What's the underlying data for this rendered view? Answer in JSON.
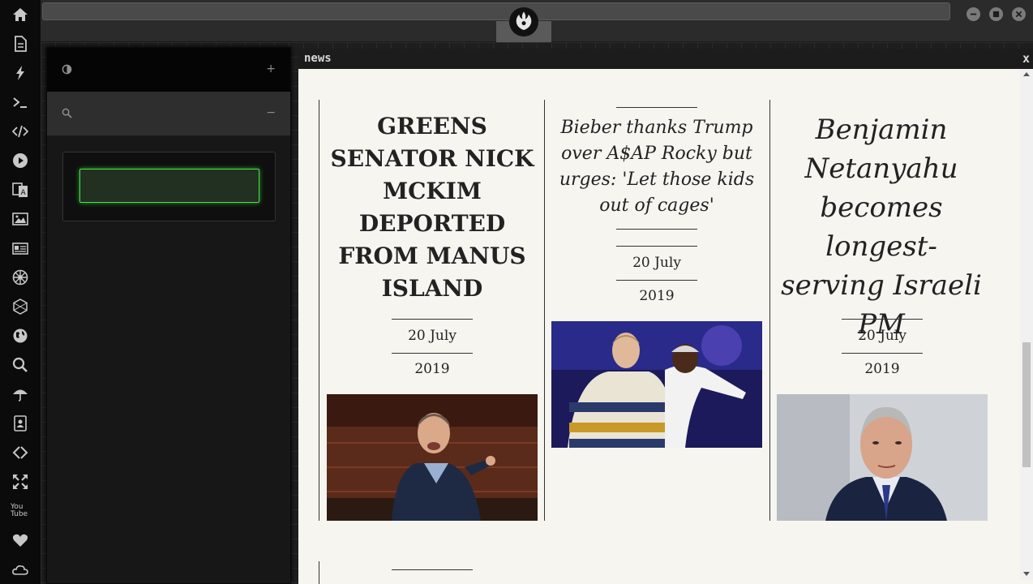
{
  "dock": {
    "items": [
      {
        "name": "home-icon"
      },
      {
        "name": "document-icon"
      },
      {
        "name": "lightning-icon"
      },
      {
        "name": "terminal-icon"
      },
      {
        "name": "code-icon"
      },
      {
        "name": "play-icon"
      },
      {
        "name": "translate-icon"
      },
      {
        "name": "image-icon"
      },
      {
        "name": "newspaper-icon"
      },
      {
        "name": "galactic-empire-icon"
      },
      {
        "name": "hexagon-network-icon"
      },
      {
        "name": "globe-icon"
      },
      {
        "name": "search-icon"
      },
      {
        "name": "umbrella-icon"
      },
      {
        "name": "contacts-icon"
      },
      {
        "name": "link-icon"
      },
      {
        "name": "expand-icon"
      },
      {
        "name": "youtube-icon"
      },
      {
        "name": "heart-icon"
      },
      {
        "name": "cloud-icon"
      }
    ],
    "youtube_label": "You Tube"
  },
  "topbar": {
    "emblem": "rebel-alliance-icon",
    "window_controls": [
      "minimize-icon",
      "maximize-icon",
      "close-icon"
    ]
  },
  "panel": {
    "header_toggle": "+",
    "search_toggle": "−",
    "search_value": ""
  },
  "news": {
    "title": "news",
    "close": "x",
    "articles": [
      {
        "headline": "Greens Senator Nick McKim deported from Manus Island",
        "date": "20 July 2019"
      },
      {
        "headline": "Bieber thanks Trump over A$AP Rocky but urges: 'Let those kids out of cages'",
        "date": "20 July 2019"
      },
      {
        "headline": "Benjamin Netanyahu becomes longest-serving Israeli PM",
        "date": "20 July 2019"
      }
    ]
  },
  "colors": {
    "dock_bg": "#0b0b0b",
    "input_glow": "#4fdc4f",
    "news_bg": "#f6f5f0"
  }
}
